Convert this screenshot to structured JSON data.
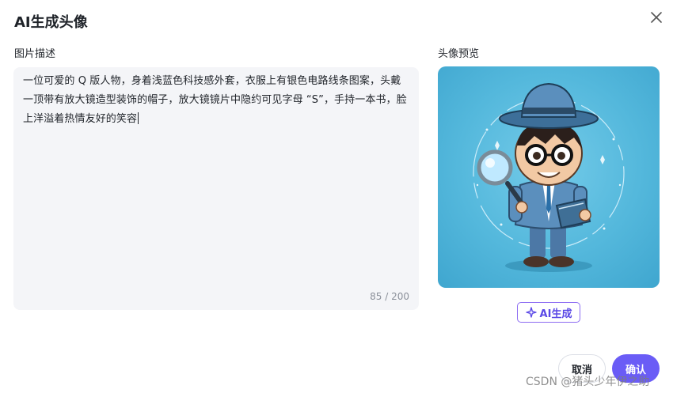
{
  "dialog": {
    "title": "AI生成头像",
    "close_icon": "close-icon"
  },
  "description": {
    "label": "图片描述",
    "text": "一位可爱的 Q 版人物，身着浅蓝色科技感外套，衣服上有银色电路线条图案，头戴一顶带有放大镜造型装饰的帽子，放大镜镜片中隐约可见字母 “S”，手持一本书，脸上洋溢着热情友好的笑容",
    "counter": "85 / 200"
  },
  "preview": {
    "label": "头像预览",
    "image_alt": "cartoon-avatar"
  },
  "ai_generate": {
    "label": "AI生成",
    "icon": "sparkle-icon",
    "accent": "#5a48e6"
  },
  "footer": {
    "cancel_label": "取消",
    "confirm_label": "确认",
    "confirm_color": "#6a5cf6"
  },
  "watermark": "CSDN @猪头少年伊之助"
}
